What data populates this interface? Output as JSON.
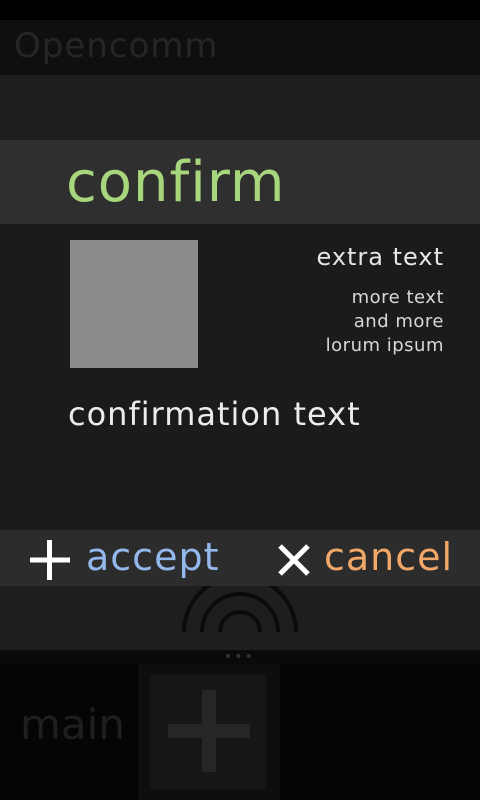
{
  "app": {
    "title": "Opencomm",
    "main_label": "main"
  },
  "dialog": {
    "title": "confirm",
    "extra_text": "extra text",
    "more_text_lines": [
      "more text",
      "and more",
      "lorum ipsum"
    ],
    "confirmation_text": "confirmation text",
    "accept_label": "accept",
    "cancel_label": "cancel"
  },
  "colors": {
    "title_green": "#a8d67c",
    "accept_blue": "#93b8ec",
    "cancel_orange": "#f2a869",
    "thumbnail_gray": "#8a8a8a"
  },
  "icons": {
    "accept": "plus-icon",
    "cancel": "close-icon",
    "background_signal": "wifi-signal-icon",
    "background_add": "plus-icon"
  }
}
